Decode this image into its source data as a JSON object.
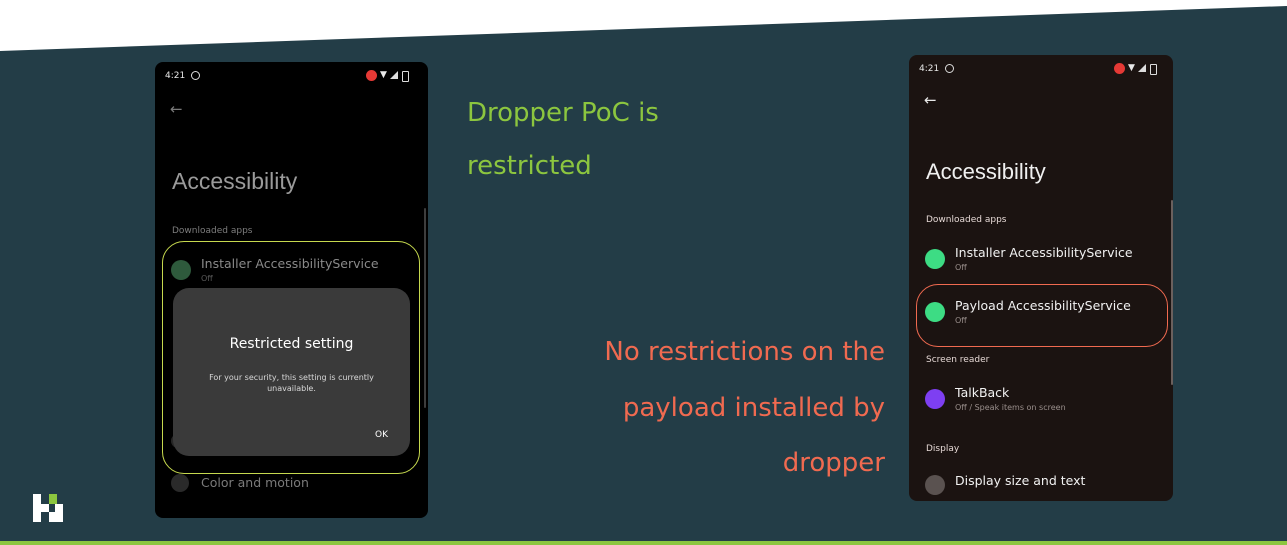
{
  "captions": {
    "restricted_line1": "Dropper PoC is",
    "restricted_line2": "restricted",
    "payload_line1": "No restrictions on the",
    "payload_line2": "payload installed by",
    "payload_line3": "dropper"
  },
  "colors": {
    "background": "#233d47",
    "accent_green": "#8cc63f",
    "accent_red": "#f06a50"
  },
  "left_phone": {
    "time": "4:21",
    "title": "Accessibility",
    "section_downloaded": "Downloaded apps",
    "installer_label": "Installer AccessibilityService",
    "installer_status": "Off",
    "color_motion_label": "Color and motion",
    "dialog": {
      "title": "Restricted setting",
      "body": "For your security, this setting is currently unavailable.",
      "ok": "OK"
    }
  },
  "right_phone": {
    "time": "4:21",
    "title": "Accessibility",
    "section_downloaded": "Downloaded apps",
    "installer_label": "Installer AccessibilityService",
    "installer_status": "Off",
    "payload_label": "Payload AccessibilityService",
    "payload_status": "Off",
    "section_screen_reader": "Screen reader",
    "talkback_label": "TalkBack",
    "talkback_status": "Off / Speak items on screen",
    "section_display": "Display",
    "display_label": "Display size and text"
  },
  "icons": [
    "back-arrow-icon",
    "android-icon",
    "talkback-icon",
    "display-size-icon",
    "color-motion-icon",
    "record-icon",
    "wifi-icon",
    "signal-icon",
    "battery-icon",
    "company-logo-icon"
  ]
}
